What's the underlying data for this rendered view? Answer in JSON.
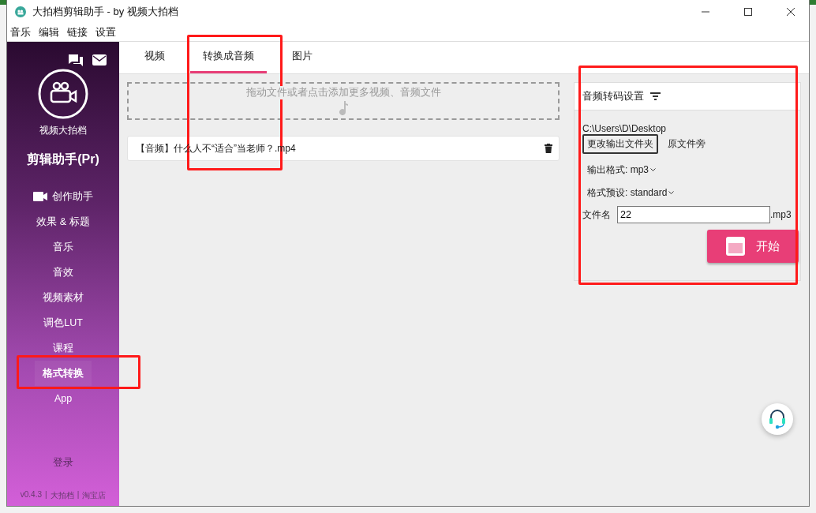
{
  "window": {
    "title": "大拍档剪辑助手 - by 视频大拍档"
  },
  "menu": [
    "音乐",
    "编辑",
    "链接",
    "设置"
  ],
  "sidebar": {
    "brand": "视频大拍档",
    "product": "剪辑助手(Pr)",
    "items": [
      {
        "label": "创作助手",
        "kind": "camera",
        "selected": false
      },
      {
        "label": "效果 & 标题",
        "kind": "plain",
        "selected": false
      },
      {
        "label": "音乐",
        "kind": "plain",
        "selected": false
      },
      {
        "label": "音效",
        "kind": "plain",
        "selected": false
      },
      {
        "label": "视频素材",
        "kind": "plain",
        "selected": false
      },
      {
        "label": "调色LUT",
        "kind": "plain",
        "selected": false
      },
      {
        "label": "课程",
        "kind": "plain",
        "selected": false
      },
      {
        "label": "格式转换",
        "kind": "plain",
        "selected": true
      },
      {
        "label": "App",
        "kind": "plain",
        "selected": false
      }
    ],
    "login": "登录",
    "footer": [
      "v0.4.3",
      "|",
      "大拍档",
      "|",
      "淘宝店"
    ]
  },
  "tabs": [
    {
      "label": "视频",
      "selected": false
    },
    {
      "label": "转换成音频",
      "selected": true
    },
    {
      "label": "图片",
      "selected": false
    }
  ],
  "dropzone": {
    "text": "拖动文件或者点击添加更多视频、音频文件"
  },
  "files": [
    {
      "name": "【音频】什么人不“适合”当老师？.mp4"
    }
  ],
  "settings": {
    "title": "音频转码设置",
    "path": "C:\\Users\\D\\Desktop",
    "change_button": "更改输出文件夹",
    "beside_button": "原文件旁",
    "format": "输出格式: mp3",
    "preset": "格式预设: standard",
    "filename_label": "文件名",
    "filename": "22",
    "extension": ".mp3",
    "start": "开始"
  }
}
